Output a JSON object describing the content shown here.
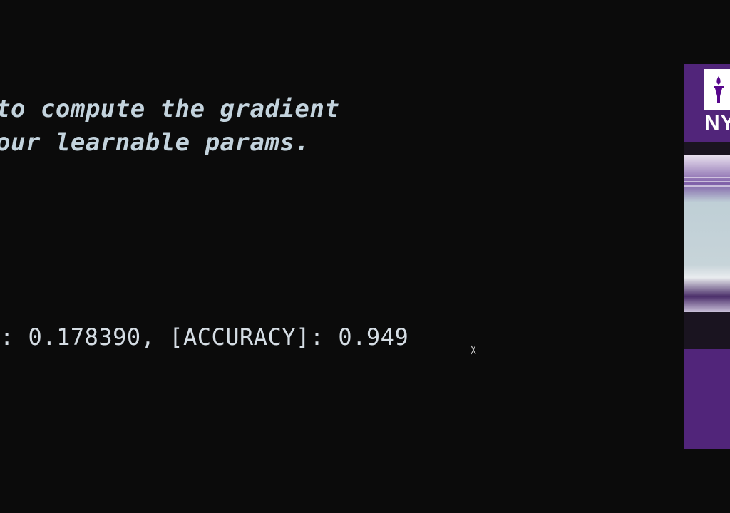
{
  "comment": {
    "line1": "to compute the gradient",
    "line2": "our learnable params."
  },
  "output": {
    "line": ": 0.178390, [ACCURACY]: 0.949"
  },
  "thumbnail": {
    "logo_text": "NY"
  },
  "colors": {
    "background": "#0b0b0b",
    "text": "#c3d3dd",
    "thumbnail_purple": "#51257a"
  },
  "icons": {
    "cursor": "text-cursor-icon",
    "logo": "torch-icon"
  }
}
